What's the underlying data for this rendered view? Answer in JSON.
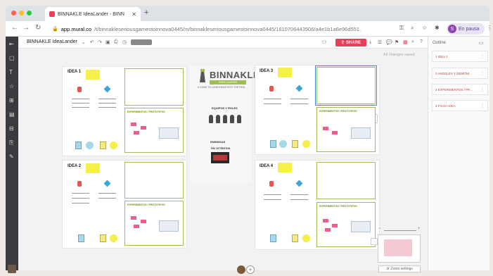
{
  "browser": {
    "tab_title": "BINNAKLE IdeaLander - BINN",
    "url_host": "app.mural.co",
    "url_path": "/t/binnakleseriousgamestoinnova0445/m/binnakleseriousgamestoinnova0445/1610706443506/a4e1b1a6e96d551...",
    "profile_initial": "S",
    "profile_label": "En pausa"
  },
  "app": {
    "board_name": "BINNAKLE IdeaLander",
    "share_label": "SHARE",
    "changes_status": "All changes saved"
  },
  "board": {
    "idea1": "IDEA 1",
    "idea2": "IDEA 2",
    "idea3": "IDEA 3",
    "idea4": "IDEA 4",
    "experimentos": "EXPERIMENTOS / PROTOTIPOS",
    "logo": "BINNAKLE",
    "logo_sub": "IDEA LANDER",
    "logo_tagline": "A GAME TO LAND IDEAS INTO THE REAL",
    "equipos": "EQUIPOS Y ROLES",
    "enemigas": "ENEMIGAS",
    "enemy_tag": "PAY ATTENTION"
  },
  "outline": {
    "header": "Outline",
    "items": [
      "1 IDEA 1",
      "2 ANGELES Y DEMONI...",
      "3 EXPERIMENTOS / PR...",
      "4 FICHA IDEA"
    ]
  },
  "zoom": {
    "settings_label": "Zoom settings"
  },
  "colors": {
    "accent": "#e83f5b",
    "green": "#9fbd52",
    "sticky": "#f6f04a"
  }
}
